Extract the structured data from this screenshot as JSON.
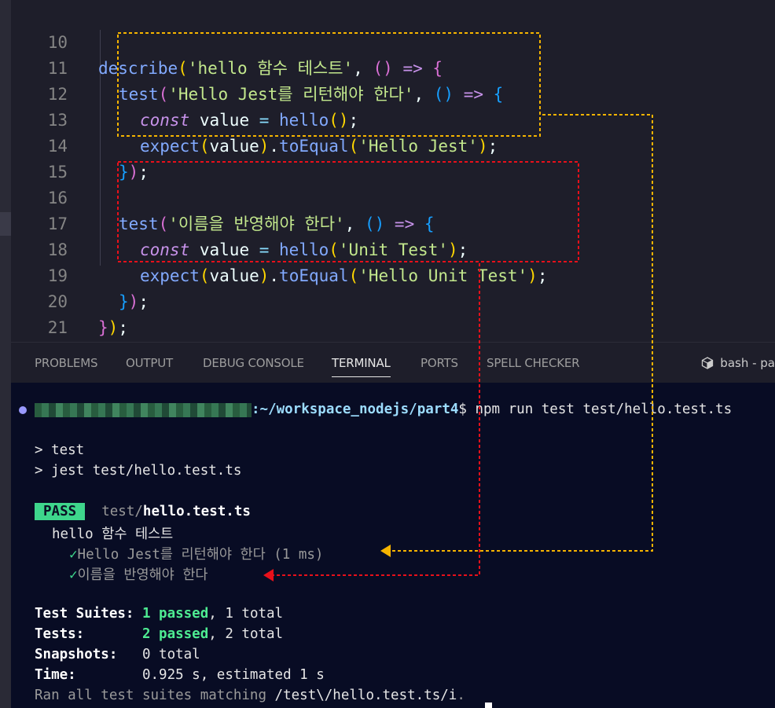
{
  "editor": {
    "lines": [
      {
        "n": "10"
      },
      {
        "n": "11"
      },
      {
        "n": "12"
      },
      {
        "n": "13"
      },
      {
        "n": "14"
      },
      {
        "n": "15"
      },
      {
        "n": "16"
      },
      {
        "n": "17"
      },
      {
        "n": "18"
      },
      {
        "n": "19"
      },
      {
        "n": "20"
      },
      {
        "n": "21"
      }
    ],
    "tokens": {
      "describe": "describe",
      "describe_name": "'hello 함수 테스트'",
      "test": "test",
      "test1_name": "'Hello Jest를 리턴해야 한다'",
      "test2_name": "'이름을 반영해야 한다'",
      "const": "const",
      "value": "value",
      "hello": "hello",
      "expect": "expect",
      "toEqual": "toEqual",
      "arg_unit": "'Unit Test'",
      "expected1": "'Hello Jest'",
      "expected2": "'Hello Unit Test'"
    }
  },
  "panel": {
    "tabs": [
      "PROBLEMS",
      "OUTPUT",
      "DEBUG CONSOLE",
      "TERMINAL",
      "PORTS",
      "SPELL CHECKER"
    ],
    "active_tab": "TERMINAL",
    "shell_label": "bash - pa"
  },
  "terminal": {
    "cwd": ":~/workspace_nodejs/part4",
    "prompt_symbol": "$",
    "command": " npm run test test/hello.test.ts",
    "script_line1": "> test",
    "script_line2": "> jest test/hello.test.ts",
    "pass_badge": "PASS",
    "file_dir": "test/",
    "file_name": "hello.test.ts",
    "suite_name": "hello 함수 테스트",
    "check": "✓",
    "test1": "Hello Jest를 리턴해야 한다",
    "test1_time": " (1 ms)",
    "test2": "이름을 반영해야 한다",
    "summary": {
      "suites_label": "Test Suites: ",
      "suites_passed": "1 passed",
      "suites_total": ", 1 total",
      "tests_label": "Tests:       ",
      "tests_passed": "2 passed",
      "tests_total": ", 2 total",
      "snapshots_label": "Snapshots:   ",
      "snapshots_value": "0 total",
      "time_label": "Time:        ",
      "time_value": "0.925 s, estimated 1 s",
      "ran_prefix": "Ran all test suites matching ",
      "ran_pattern": "/test\\/hello.test.ts/i",
      "ran_suffix": "."
    }
  },
  "colors": {
    "annotation_yellow": "#f5b400",
    "annotation_red": "#e8101a",
    "pass_badge_bg": "#3ed68c"
  }
}
